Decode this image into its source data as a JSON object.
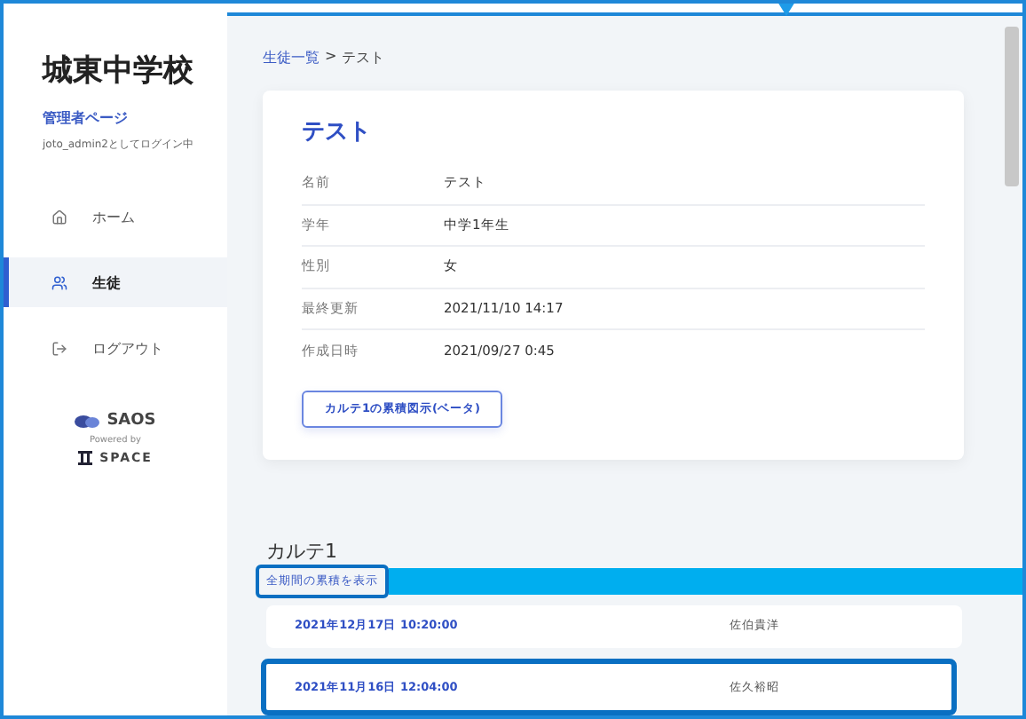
{
  "sidebar": {
    "school": "城東中学校",
    "role": "管理者ページ",
    "login_text": "joto_admin2としてログイン中",
    "items": [
      {
        "label": "ホーム",
        "kind": "home",
        "selected": false
      },
      {
        "label": "生徒",
        "kind": "students",
        "selected": true
      },
      {
        "label": "ログアウト",
        "kind": "logout",
        "selected": false
      }
    ],
    "brand": {
      "name": "SAOS",
      "powered_by": "Powered by",
      "partner": "SPACE"
    }
  },
  "breadcrumb": {
    "parent": "生徒一覧",
    "separator": ">",
    "current": "テスト"
  },
  "student": {
    "title": "テスト",
    "fields": [
      {
        "label": "名前",
        "value": "テスト"
      },
      {
        "label": "学年",
        "value": "中学1年生"
      },
      {
        "label": "性別",
        "value": "女"
      },
      {
        "label": "最終更新",
        "value": "2021/11/10 14:17"
      },
      {
        "label": "作成日時",
        "value": "2021/09/27 0:45"
      }
    ],
    "button": "カルテ1の累積図示(ベータ)"
  },
  "karte": {
    "title": "カルテ1",
    "link": {
      "label": "全期間の累積を表示",
      "highlighted": true
    },
    "records": [
      {
        "date": "2021年12月17日 10:20:00",
        "author": "佐伯貴洋",
        "highlighted": false
      },
      {
        "date": "2021年11月16日 12:04:00",
        "author": "佐久裕昭",
        "highlighted": true
      }
    ]
  }
}
